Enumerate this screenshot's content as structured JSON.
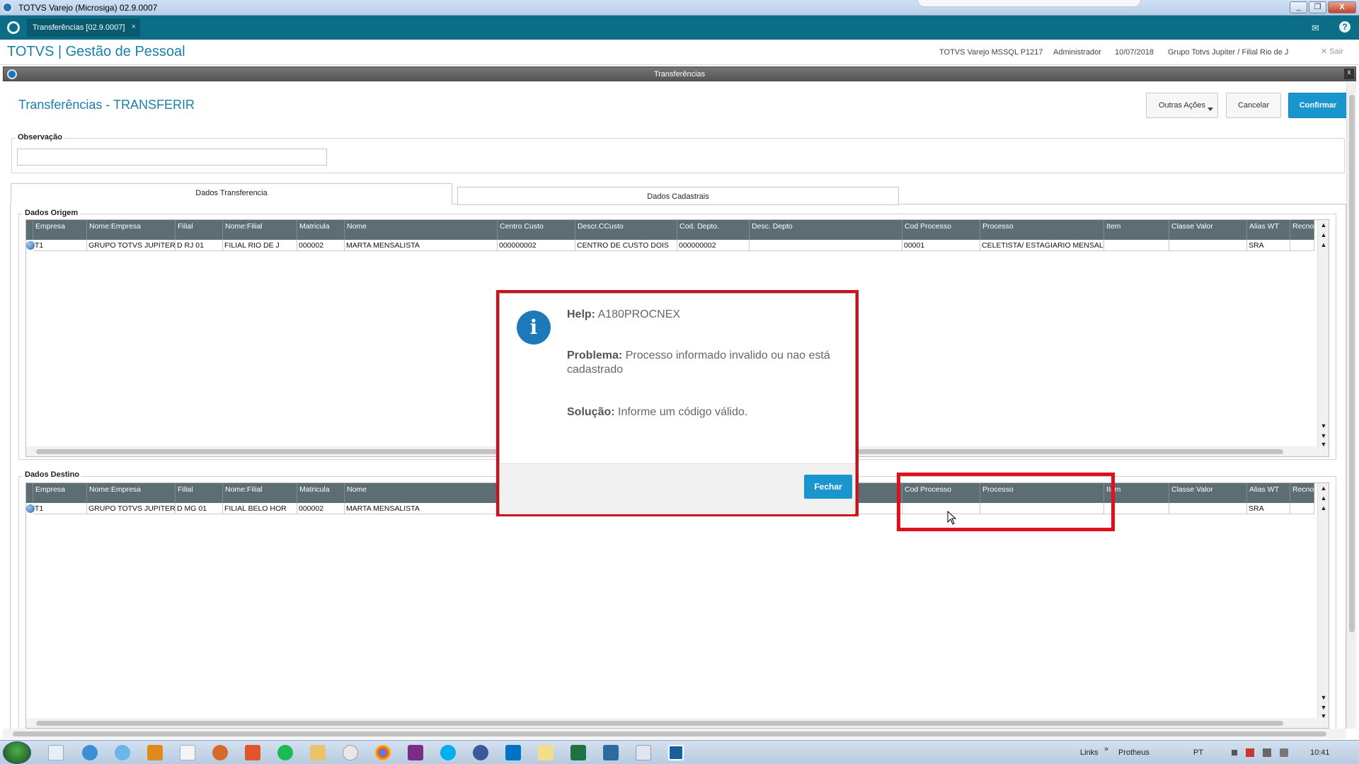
{
  "window": {
    "title": "TOTVS Varejo (Microsiga) 02.9.0007",
    "controls": [
      "_",
      "❐",
      "X"
    ]
  },
  "tabbar": {
    "tab_label": "Transferências [02.9.0007]",
    "tab_close": "×",
    "mail_icon": "✉",
    "help_icon": "?"
  },
  "header": {
    "brand": "TOTVS | Gestão de Pessoal",
    "environment": "TOTVS Varejo MSSQL P1217",
    "user": "Administrador",
    "date": "10/07/2018",
    "company": "Grupo Totvs Jupiter / Filial Rio de J",
    "exit": "✕  Sair"
  },
  "dialog": {
    "title": "Transferências",
    "close": "x",
    "page_title": "Transferências - TRANSFERIR",
    "buttons": {
      "more_actions": "Outras Ações",
      "cancel": "Cancelar",
      "confirm": "Confirmar"
    },
    "observacao_label": "Observação",
    "observacao_value": "",
    "tabs": [
      "Dados Transferencia",
      "Dados Cadastrais"
    ],
    "active_tab": "Dados Transferencia"
  },
  "grids": {
    "columns": [
      "Empresa",
      "Nome:Empresa",
      "Filial",
      "Nome:Filial",
      "Matricula",
      "Nome",
      "Centro Custo",
      "Descr.CCusto",
      "Cod. Depto.",
      "Desc. Depto",
      "Cod Processo",
      "Processo",
      "Item",
      "Classe Valor",
      "Alias WT",
      "Recno"
    ],
    "origem": {
      "label": "Dados Origem",
      "rows": [
        [
          "T1",
          "GRUPO TOTVS JUPITER",
          "D RJ 01",
          "FILIAL RIO DE J",
          "000002",
          "MARTA MENSALISTA",
          "000000002",
          "CENTRO DE CUSTO DOIS",
          "000000002",
          "",
          "00001",
          "CELETISTA/ ESTAGIARIO MENSAL",
          "",
          "",
          "SRA",
          ""
        ]
      ]
    },
    "destino": {
      "label": "Dados Destino",
      "rows": [
        [
          "T1",
          "GRUPO TOTVS JUPITER",
          "D MG 01",
          "FILIAL BELO HOR",
          "000002",
          "MARTA MENSALISTA",
          "",
          "",
          "",
          "",
          "",
          "",
          "",
          "",
          "SRA",
          ""
        ]
      ]
    }
  },
  "popup": {
    "icon": "i",
    "help_label": "Help:",
    "help_value": "A180PROCNEX",
    "problem_label": "Problema:",
    "problem_value": "Processo informado invalido ou nao está cadastrado",
    "solution_label": "Solução:",
    "solution_value": "Informe um código válido.",
    "close_button": "Fechar"
  },
  "taskbar": {
    "links": "Links",
    "chevron": "»",
    "protheus": "Protheus",
    "lang": "PT",
    "time": "10:41"
  },
  "colors": {
    "accent": "#1c7fa6",
    "tabbar": "#0c6d86",
    "primary_button": "#1a96cf",
    "grid_header": "#5d6d74",
    "highlight": "#e0111b"
  }
}
